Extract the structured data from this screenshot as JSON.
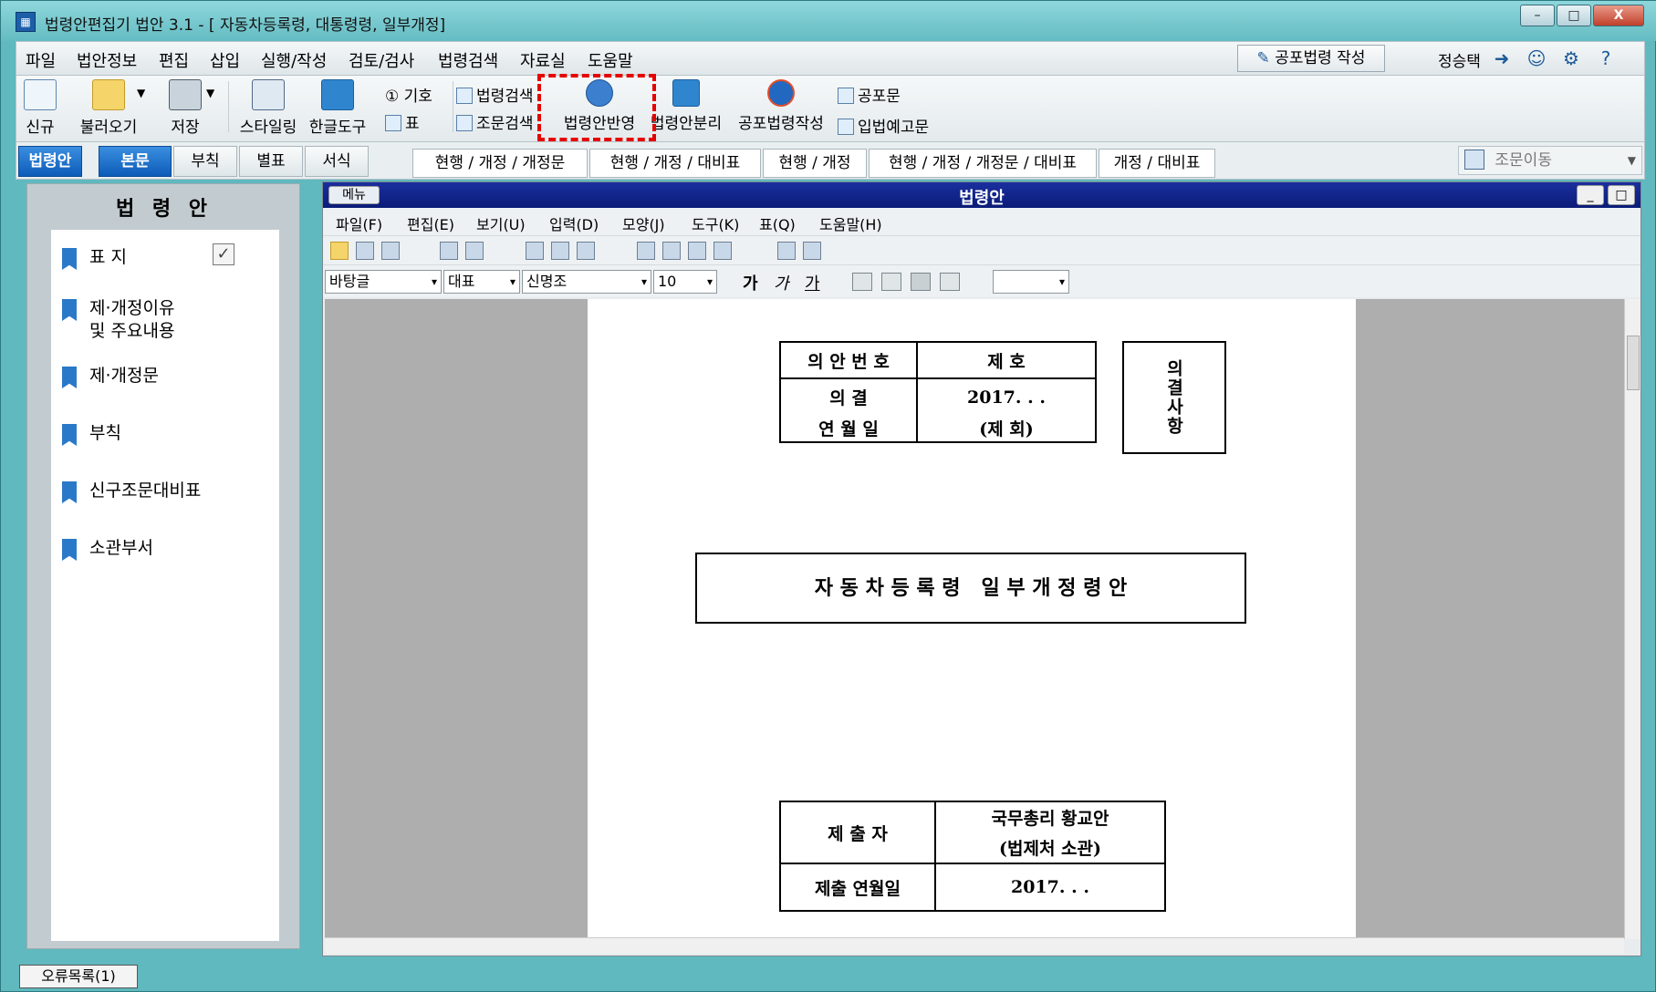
{
  "window": {
    "title": "법령안편집기 법안 3.1 - [ 자동차등록령, 대통령령, 일부개정]",
    "controls": {
      "minimize": "–",
      "maximize": "□",
      "close": "X"
    }
  },
  "menubar": {
    "items": [
      "파일",
      "법안정보",
      "편집",
      "삽입",
      "실행/작성",
      "검토/검사",
      "법령검색",
      "자료실",
      "도움말"
    ],
    "publish_button": "공포법령 작성",
    "user": "정승택"
  },
  "toolbar": {
    "new": "신규",
    "open": "불러오기",
    "save": "저장",
    "styling": "스타일링",
    "hangul_tool": "한글도구",
    "symbol": "① 기호",
    "table": "표",
    "law_search": "법령검색",
    "article_search": "조문검색",
    "apply_bill": "법령안반영",
    "separate_bill": "법령안분리",
    "publish_write": "공포법령작성",
    "promulgation": "공포문",
    "pre_notice": "입법예고문"
  },
  "left_tabs": [
    "법령안",
    "본문",
    "부칙",
    "별표",
    "서식"
  ],
  "view_tabs": [
    "현행 / 개정 / 개정문",
    "현행 / 개정 / 대비표",
    "현행 / 개정",
    "현행 / 개정 / 개정문 / 대비표",
    "개정 / 대비표"
  ],
  "article_jump": {
    "placeholder": "조문이동"
  },
  "left_panel": {
    "title": "법 령 안",
    "items": [
      {
        "line1": "표       지",
        "line2": "",
        "checked": true
      },
      {
        "line1": "제·개정이유",
        "line2": "및 주요내용"
      },
      {
        "line1": "제·개정문",
        "line2": ""
      },
      {
        "line1": "부칙",
        "line2": ""
      },
      {
        "line1": "신구조문대비표",
        "line2": ""
      },
      {
        "line1": "소관부서",
        "line2": ""
      }
    ],
    "check_mark": "✓"
  },
  "editor": {
    "menu_button": "메뉴",
    "title": "법령안",
    "min_btn": "_",
    "max_btn": "□",
    "menu": [
      "파일(F)",
      "편집(E)",
      "보기(U)",
      "입력(D)",
      "모양(J)",
      "도구(K)",
      "표(Q)",
      "도움말(H)"
    ],
    "style_dd": "바탕글",
    "outline_dd": "대표",
    "font_dd": "신명조",
    "size_dd": "10",
    "bold": "가",
    "italic": "가",
    "underline": "가",
    "arrow": "▾"
  },
  "document": {
    "bill_table": {
      "no_label": "의 안 번 호",
      "no_value": "제        호",
      "date_label_1": "의        결",
      "date_label_2": "연  월  일",
      "date_value_1": "2017.   .   .",
      "date_value_2": "(제      회)",
      "side": "의결사항"
    },
    "bill_title": "자 동 차 등 록 령   일 부 개 정 령 안",
    "submit_table": {
      "submitter_label": "제  출  자",
      "submitter_value_1": "국무총리 황교안",
      "submitter_value_2": "(법제처 소관)",
      "submit_date_label": "제출 연월일",
      "submit_date_value": "2017.   .   ."
    }
  },
  "status": {
    "error_list": "오류목록(1)"
  }
}
